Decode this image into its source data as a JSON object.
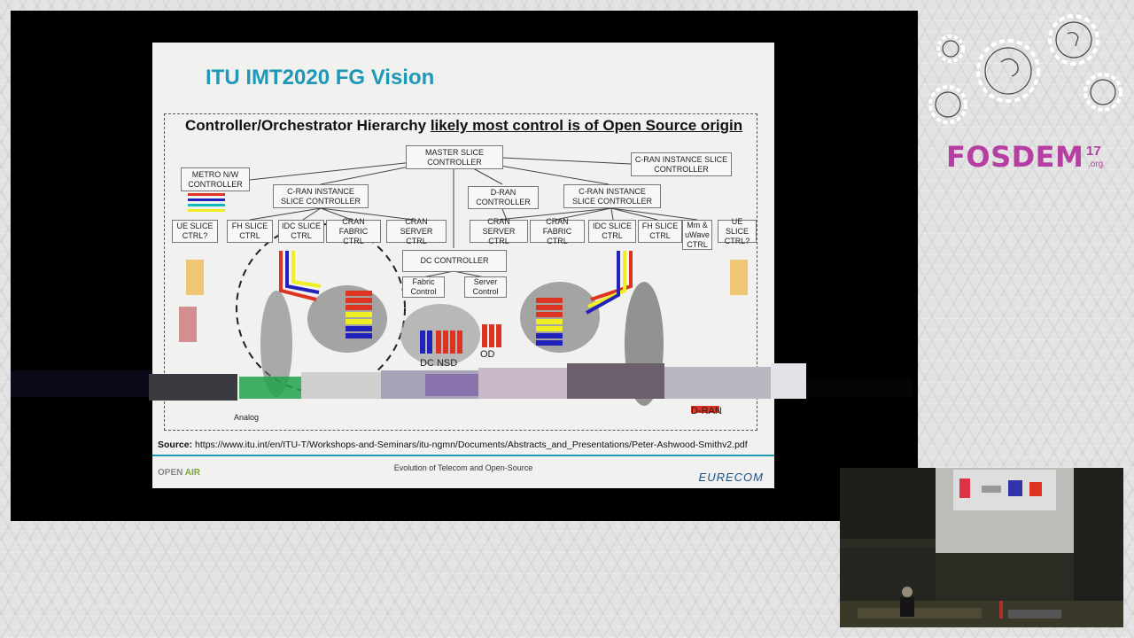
{
  "slide": {
    "title": "ITU IMT2020 FG Vision",
    "heading_plain": "Controller/Orchestrator Hierarchy ",
    "heading_underlined": "likely most control is of Open Source origin",
    "boxes": {
      "master": "MASTER SLICE CONTROLLER",
      "cran_right_top": "C-RAN INSTANCE SLICE CONTROLLER",
      "metro": "METRO N/W CONTROLLER",
      "cran_left": "C-RAN INSTANCE SLICE CONTROLLER",
      "dran": "D-RAN CONTROLLER",
      "cran_right": "C-RAN INSTANCE SLICE CONTROLLER",
      "ue_left": "UE SLICE CTRL?",
      "fh_left": "FH SLICE CTRL",
      "idc_left": "IDC SLICE CTRL",
      "cran_fabric_left": "CRAN FABRIC CTRL",
      "cran_server_left": "CRAN SERVER CTRL",
      "cran_server_right": "CRAN SERVER CTRL",
      "cran_fabric_right": "CRAN FABRIC CTRL",
      "idc_right": "IDC SLICE CTRL",
      "fh_right": "FH SLICE CTRL",
      "mm": "Mm & uWave CTRL",
      "ue_right": "UE SLICE CTRL?",
      "dc": "DC CONTROLLER",
      "fabric": "Fabric Control",
      "server": "Server Control"
    },
    "labels": {
      "od": "OD",
      "dcnsd": "DC NSD",
      "dran_label": "D-RAN",
      "analog": "Analog"
    },
    "source_label": "Source:",
    "source_url": "https://www.itu.int/en/ITU-T/Workshops-and-Seminars/itu-ngmn/Documents/Abstracts_and_Presentations/Peter-Ashwood-Smithv2.pdf",
    "footer_center": "Evolution of Telecom and Open-Source",
    "footer_left": "OPEN",
    "footer_left_accent": "AIR",
    "footer_right": "EURECOM"
  },
  "branding": {
    "fosdem_word": "FOSDEM",
    "fosdem_year": "17",
    "fosdem_org": ".org",
    "icons": [
      "gear-icon",
      "gear-icon",
      "gear-icon",
      "gear-icon",
      "gear-icon"
    ]
  },
  "colors": {
    "title": "#1d98b7",
    "fosdem": "#b63da2",
    "eurecom": "#1a4f86"
  }
}
